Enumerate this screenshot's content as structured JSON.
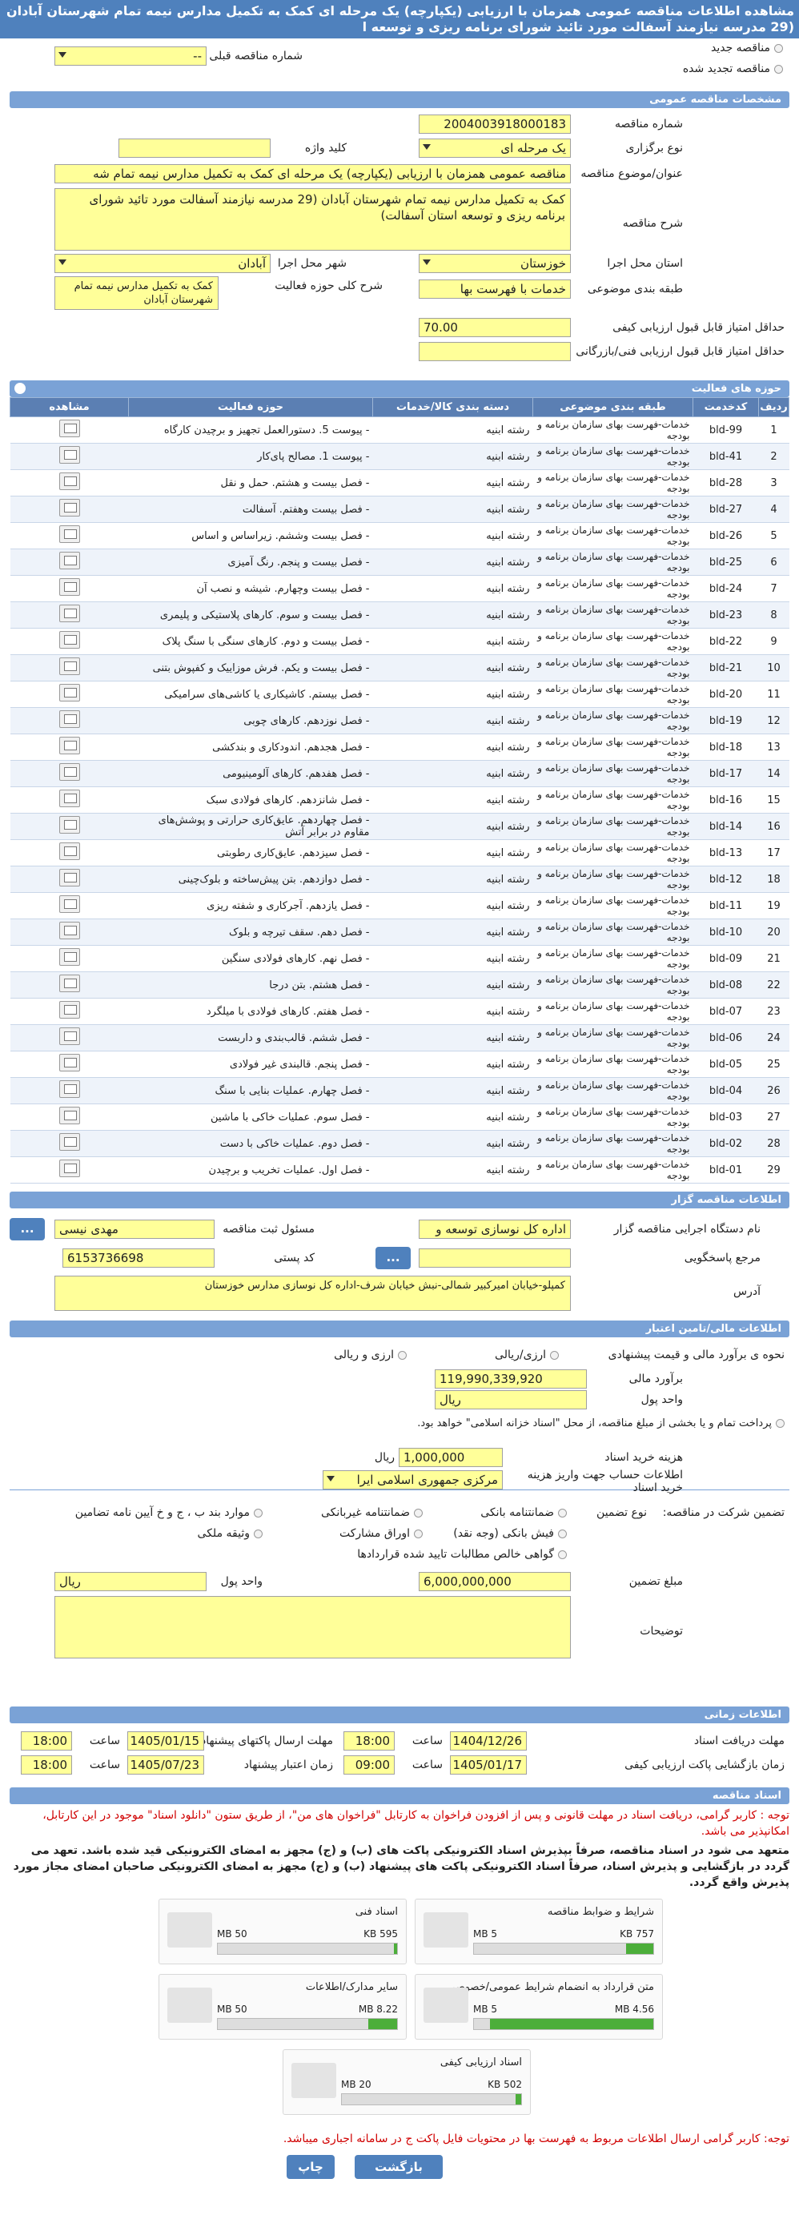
{
  "page_title": "مشاهده اطلاعات مناقصه عمومی همزمان با ارزیابی (یکپارچه) یک مرحله ای کمک به تکمیل مدارس نیمه تمام شهرستان آبادان (29 مدرسه نیازمند آسفالت مورد تائید شورای برنامه ریزی و توسعه ا",
  "options": {
    "new_tender": "مناقصه جدید",
    "renewed_tender": "مناقصه تجدید شده",
    "previous_tender_no_label": "شماره مناقصه قبلی",
    "previous_tender_no_value": "--"
  },
  "general": {
    "header": "مشخصات مناقصه عمومی",
    "tender_no_label": "شماره مناقصه",
    "tender_no": "2004003918000183",
    "holding_type_label": "نوع برگزاری",
    "holding_type": "یک مرحله ای",
    "keyword_label": "کلید واژه",
    "keyword": "",
    "subject_label": "عنوان/موضوع مناقصه",
    "subject": "مناقصه عمومی همزمان با ارزیابی (یکپارچه) یک مرحله ای کمک به تکمیل مدارس نیمه تمام شه",
    "description_label": "شرح مناقصه",
    "description": "کمک به تکمیل مدارس نیمه تمام شهرستان آبادان (29 مدرسه نیازمند آسفالت مورد تائید شورای برنامه ریزی و توسعه استان آسفالت)",
    "province_label": "استان محل اجرا",
    "province": "خوزستان",
    "city_label": "شهر محل اجرا",
    "city": "آبادان",
    "category_label": "طبقه بندی موضوعی",
    "category": "خدمات با فهرست بها",
    "activity_desc_label": "شرح کلی حوزه فعالیت",
    "activity_desc": "کمک به تکمیل مدارس نیمه تمام شهرستان آبادان",
    "min_quality_label": "حداقل امتیاز قابل قبول ارزیابی کیفی",
    "min_quality": "70.00",
    "min_tech_label": "حداقل امتیاز قابل قبول ارزیابی فنی/بازرگانی",
    "min_tech": ""
  },
  "activities": {
    "header": "حوزه های فعالیت",
    "columns": [
      "ردیف",
      "کدخدمت",
      "طبقه بندی موضوعی",
      "دسته بندی کالا/خدمات",
      "حوزه فعالیت",
      "مشاهده"
    ],
    "rows": [
      [
        "1",
        "bld-99",
        "خدمات-فهرست بهای سازمان برنامه و بودجه",
        "رشته ابنیه",
        "- پیوست 5. دستورالعمل تجهیز و برچیدن کارگاه"
      ],
      [
        "2",
        "bld-41",
        "خدمات-فهرست بهای سازمان برنامه و بودجه",
        "رشته ابنیه",
        "- پیوست 1. مصالح پای‌کار"
      ],
      [
        "3",
        "bld-28",
        "خدمات-فهرست بهای سازمان برنامه و بودجه",
        "رشته ابنیه",
        "- فصل بیست و هشتم. حمل و نقل"
      ],
      [
        "4",
        "bld-27",
        "خدمات-فهرست بهای سازمان برنامه و بودجه",
        "رشته ابنیه",
        "- فصل بیست وهفتم. آسفالت"
      ],
      [
        "5",
        "bld-26",
        "خدمات-فهرست بهای سازمان برنامه و بودجه",
        "رشته ابنیه",
        "- فصل بیست وششم. زیراساس و اساس"
      ],
      [
        "6",
        "bld-25",
        "خدمات-فهرست بهای سازمان برنامه و بودجه",
        "رشته ابنیه",
        "- فصل بیست و پنجم. رنگ آمیزی"
      ],
      [
        "7",
        "bld-24",
        "خدمات-فهرست بهای سازمان برنامه و بودجه",
        "رشته ابنیه",
        "- فصل بیست وچهارم. شیشه و نصب آن"
      ],
      [
        "8",
        "bld-23",
        "خدمات-فهرست بهای سازمان برنامه و بودجه",
        "رشته ابنیه",
        "- فصل بیست و سوم. کارهای پلاستیکی و پلیمری"
      ],
      [
        "9",
        "bld-22",
        "خدمات-فهرست بهای سازمان برنامه و بودجه",
        "رشته ابنیه",
        "- فصل بیست و دوم. کارهای سنگی با سنگ پلاک"
      ],
      [
        "10",
        "bld-21",
        "خدمات-فهرست بهای سازمان برنامه و بودجه",
        "رشته ابنیه",
        "- فصل بیست و یکم. فرش موزاییک و کفپوش بتنی"
      ],
      [
        "11",
        "bld-20",
        "خدمات-فهرست بهای سازمان برنامه و بودجه",
        "رشته ابنیه",
        "- فصل بیستم. کاشیکاری یا کاشی‌های سرامیکی"
      ],
      [
        "12",
        "bld-19",
        "خدمات-فهرست بهای سازمان برنامه و بودجه",
        "رشته ابنیه",
        "- فصل نوزدهم. کارهای چوبی"
      ],
      [
        "13",
        "bld-18",
        "خدمات-فهرست بهای سازمان برنامه و بودجه",
        "رشته ابنیه",
        "- فصل هجدهم. اندودکاری و بندکشی"
      ],
      [
        "14",
        "bld-17",
        "خدمات-فهرست بهای سازمان برنامه و بودجه",
        "رشته ابنیه",
        "- فصل هفدهم. کارهای آلومینیومی"
      ],
      [
        "15",
        "bld-16",
        "خدمات-فهرست بهای سازمان برنامه و بودجه",
        "رشته ابنیه",
        "- فصل شانزدهم. کارهای فولادی سبک"
      ],
      [
        "16",
        "bld-14",
        "خدمات-فهرست بهای سازمان برنامه و بودجه",
        "رشته ابنیه",
        "- فصل چهاردهم. عایق‌کاری حرارتی و پوشش‌های مقاوم در برابر آتش"
      ],
      [
        "17",
        "bld-13",
        "خدمات-فهرست بهای سازمان برنامه و بودجه",
        "رشته ابنیه",
        "- فصل سیزدهم. عایق‌کاری رطوبتی"
      ],
      [
        "18",
        "bld-12",
        "خدمات-فهرست بهای سازمان برنامه و بودجه",
        "رشته ابنیه",
        "- فصل دوازدهم. بتن پیش‌ساخته و بلوک‌چینی"
      ],
      [
        "19",
        "bld-11",
        "خدمات-فهرست بهای سازمان برنامه و بودجه",
        "رشته ابنیه",
        "- فصل یازدهم. آجرکاری و شفته ریزی"
      ],
      [
        "20",
        "bld-10",
        "خدمات-فهرست بهای سازمان برنامه و بودجه",
        "رشته ابنیه",
        "- فصل دهم. سقف تیرچه و بلوک"
      ],
      [
        "21",
        "bld-09",
        "خدمات-فهرست بهای سازمان برنامه و بودجه",
        "رشته ابنیه",
        "- فصل نهم. کارهای فولادی سنگین"
      ],
      [
        "22",
        "bld-08",
        "خدمات-فهرست بهای سازمان برنامه و بودجه",
        "رشته ابنیه",
        "- فصل هشتم. بتن درجا"
      ],
      [
        "23",
        "bld-07",
        "خدمات-فهرست بهای سازمان برنامه و بودجه",
        "رشته ابنیه",
        "- فصل هفتم. کارهای فولادی با میلگرد"
      ],
      [
        "24",
        "bld-06",
        "خدمات-فهرست بهای سازمان برنامه و بودجه",
        "رشته ابنیه",
        "- فصل ششم. قالب‌بندی و داربست"
      ],
      [
        "25",
        "bld-05",
        "خدمات-فهرست بهای سازمان برنامه و بودجه",
        "رشته ابنیه",
        "- فصل پنجم. قالبندی غیر فولادی"
      ],
      [
        "26",
        "bld-04",
        "خدمات-فهرست بهای سازمان برنامه و بودجه",
        "رشته ابنیه",
        "- فصل چهارم. عملیات بنایی با سنگ"
      ],
      [
        "27",
        "bld-03",
        "خدمات-فهرست بهای سازمان برنامه و بودجه",
        "رشته ابنیه",
        "- فصل سوم. عملیات خاکی با ماشین"
      ],
      [
        "28",
        "bld-02",
        "خدمات-فهرست بهای سازمان برنامه و بودجه",
        "رشته ابنیه",
        "- فصل دوم. عملیات خاکی با دست"
      ],
      [
        "29",
        "bld-01",
        "خدمات-فهرست بهای سازمان برنامه و بودجه",
        "رشته ابنیه",
        "- فصل اول. عملیات تخریب و برچیدن"
      ]
    ]
  },
  "organizer": {
    "header": "اطلاعات مناقصه گزار",
    "org_label": "نام دستگاه اجرایی مناقصه گزار",
    "org": "اداره کل نوسازی  توسعه و",
    "responsible_label": "مسئول ثبت مناقصه",
    "responsible": "مهدی نیسی",
    "ref_label": "مرجع پاسخگویی",
    "ref": "",
    "postal_label": "کد پستی",
    "postal": "6153736698",
    "address_label": "آدرس",
    "address": "کمپلو-خیابان امیرکبیر شمالی-نبش خیابان شرف-اداره کل نوسازی مدارس خوزستان",
    "dots": "..."
  },
  "finance": {
    "header": "اطلاعات مالی/تامین اعتبار",
    "estimate_type_label": "نحوه ی برآورد مالی و قیمت پیشنهادی",
    "rial": "ارزی/ریالی",
    "arz": "ارزی و ریالی",
    "estimate_label": "برآورد مالی",
    "estimate": "119,990,339,920",
    "currency_label": "واحد پول",
    "currency": "ریال",
    "payment_note": "پرداخت تمام و یا بخشی از مبلغ مناقصه، از محل \"اسناد خزانه اسلامی\" خواهد بود.",
    "doc_fee_label": "هزینه خرید اسناد",
    "doc_fee": "1,000,000",
    "doc_fee_unit": "ریال",
    "account_label": "اطلاعات حساب جهت واریز هزینه خرید اسناد",
    "account": "مرکزی جمهوری اسلامی ایرا"
  },
  "guarantee": {
    "label": "تضمین شرکت در مناقصه:",
    "type_label": "نوع تضمین",
    "items": [
      "ضمانتنامه بانکی",
      "ضمانتنامه غیربانکی",
      "موارد بند ب ، ج و خ آیین نامه تضامین",
      "فیش بانکی (وجه نقد)",
      "اوراق مشارکت",
      "وثیقه ملکی",
      "گواهی خالص مطالبات تایید شده قراردادها"
    ],
    "amount_label": "مبلغ تضمین",
    "amount": "6,000,000,000",
    "currency_label": "واحد پول",
    "currency": "ریال",
    "notes_label": "توضیحات",
    "notes": ""
  },
  "timing": {
    "header": "اطلاعات زمانی",
    "get_docs_label": "مهلت دریافت اسناد",
    "get_docs_date": "1404/12/26",
    "get_docs_time": "18:00",
    "send_label": "مهلت ارسال پاکتهای پیشنهاد",
    "send_date": "1405/01/15",
    "send_time": "18:00",
    "open_label": "زمان بازگشایی پاکت ارزیابی کیفی",
    "open_date": "1405/01/17",
    "open_time": "09:00",
    "validity_label": "زمان اعتبار پیشنهاد",
    "validity_date": "1405/07/23",
    "validity_time": "18:00",
    "time_label": "ساعت"
  },
  "documents": {
    "header": "اسناد مناقصه",
    "note1": "توجه : کاربر گرامی، دریافت اسناد در مهلت قانونی و پس از افزودن فراخوان به کارتابل \"فراخوان های من\"، از طریق ستون \"دانلود اسناد\" موجود در این کارتابل، امکانپذیر می باشد.",
    "note2": "متعهد می شود در اسناد مناقصه، صرفاً بپذیرش اسناد الکترونیکی پاکت های (ب) و (ج) مجهز به امضای الکترونیکی قید شده باشد. تعهد می گردد در بازگشایی و پذیرش اسناد، صرفاً اسناد الکترونیکی پاکت های پیشنهاد (ب) و (ج) مجهز به امضای الکترونیکی صاحبان امضای مجاز مورد پذیرش واقع گردد.",
    "files": [
      {
        "name": "شرایط و ضوابط مناقصه",
        "size": "757 KB",
        "max": "5 MB",
        "fill": 0.15
      },
      {
        "name": "اسناد فنی",
        "size": "595 KB",
        "max": "50 MB",
        "fill": 0.02
      },
      {
        "name": "متن قرارداد به انضمام شرایط عمومی/خصوصی",
        "size": "4.56 MB",
        "max": "5 MB",
        "fill": 0.91
      },
      {
        "name": "سایر مدارک/اطلاعات",
        "size": "8.22 MB",
        "max": "50 MB",
        "fill": 0.16
      },
      {
        "name": "اسناد ارزیابی کیفی",
        "size": "502 KB",
        "max": "20 MB",
        "fill": 0.03
      }
    ],
    "note3": "توجه: کاربر گرامی ارسال اطلاعات مربوط به فهرست بها در محتویات فایل پاکت ج در سامانه اجباری میباشد."
  },
  "buttons": {
    "back": "بازگشت",
    "print": "چاپ"
  }
}
